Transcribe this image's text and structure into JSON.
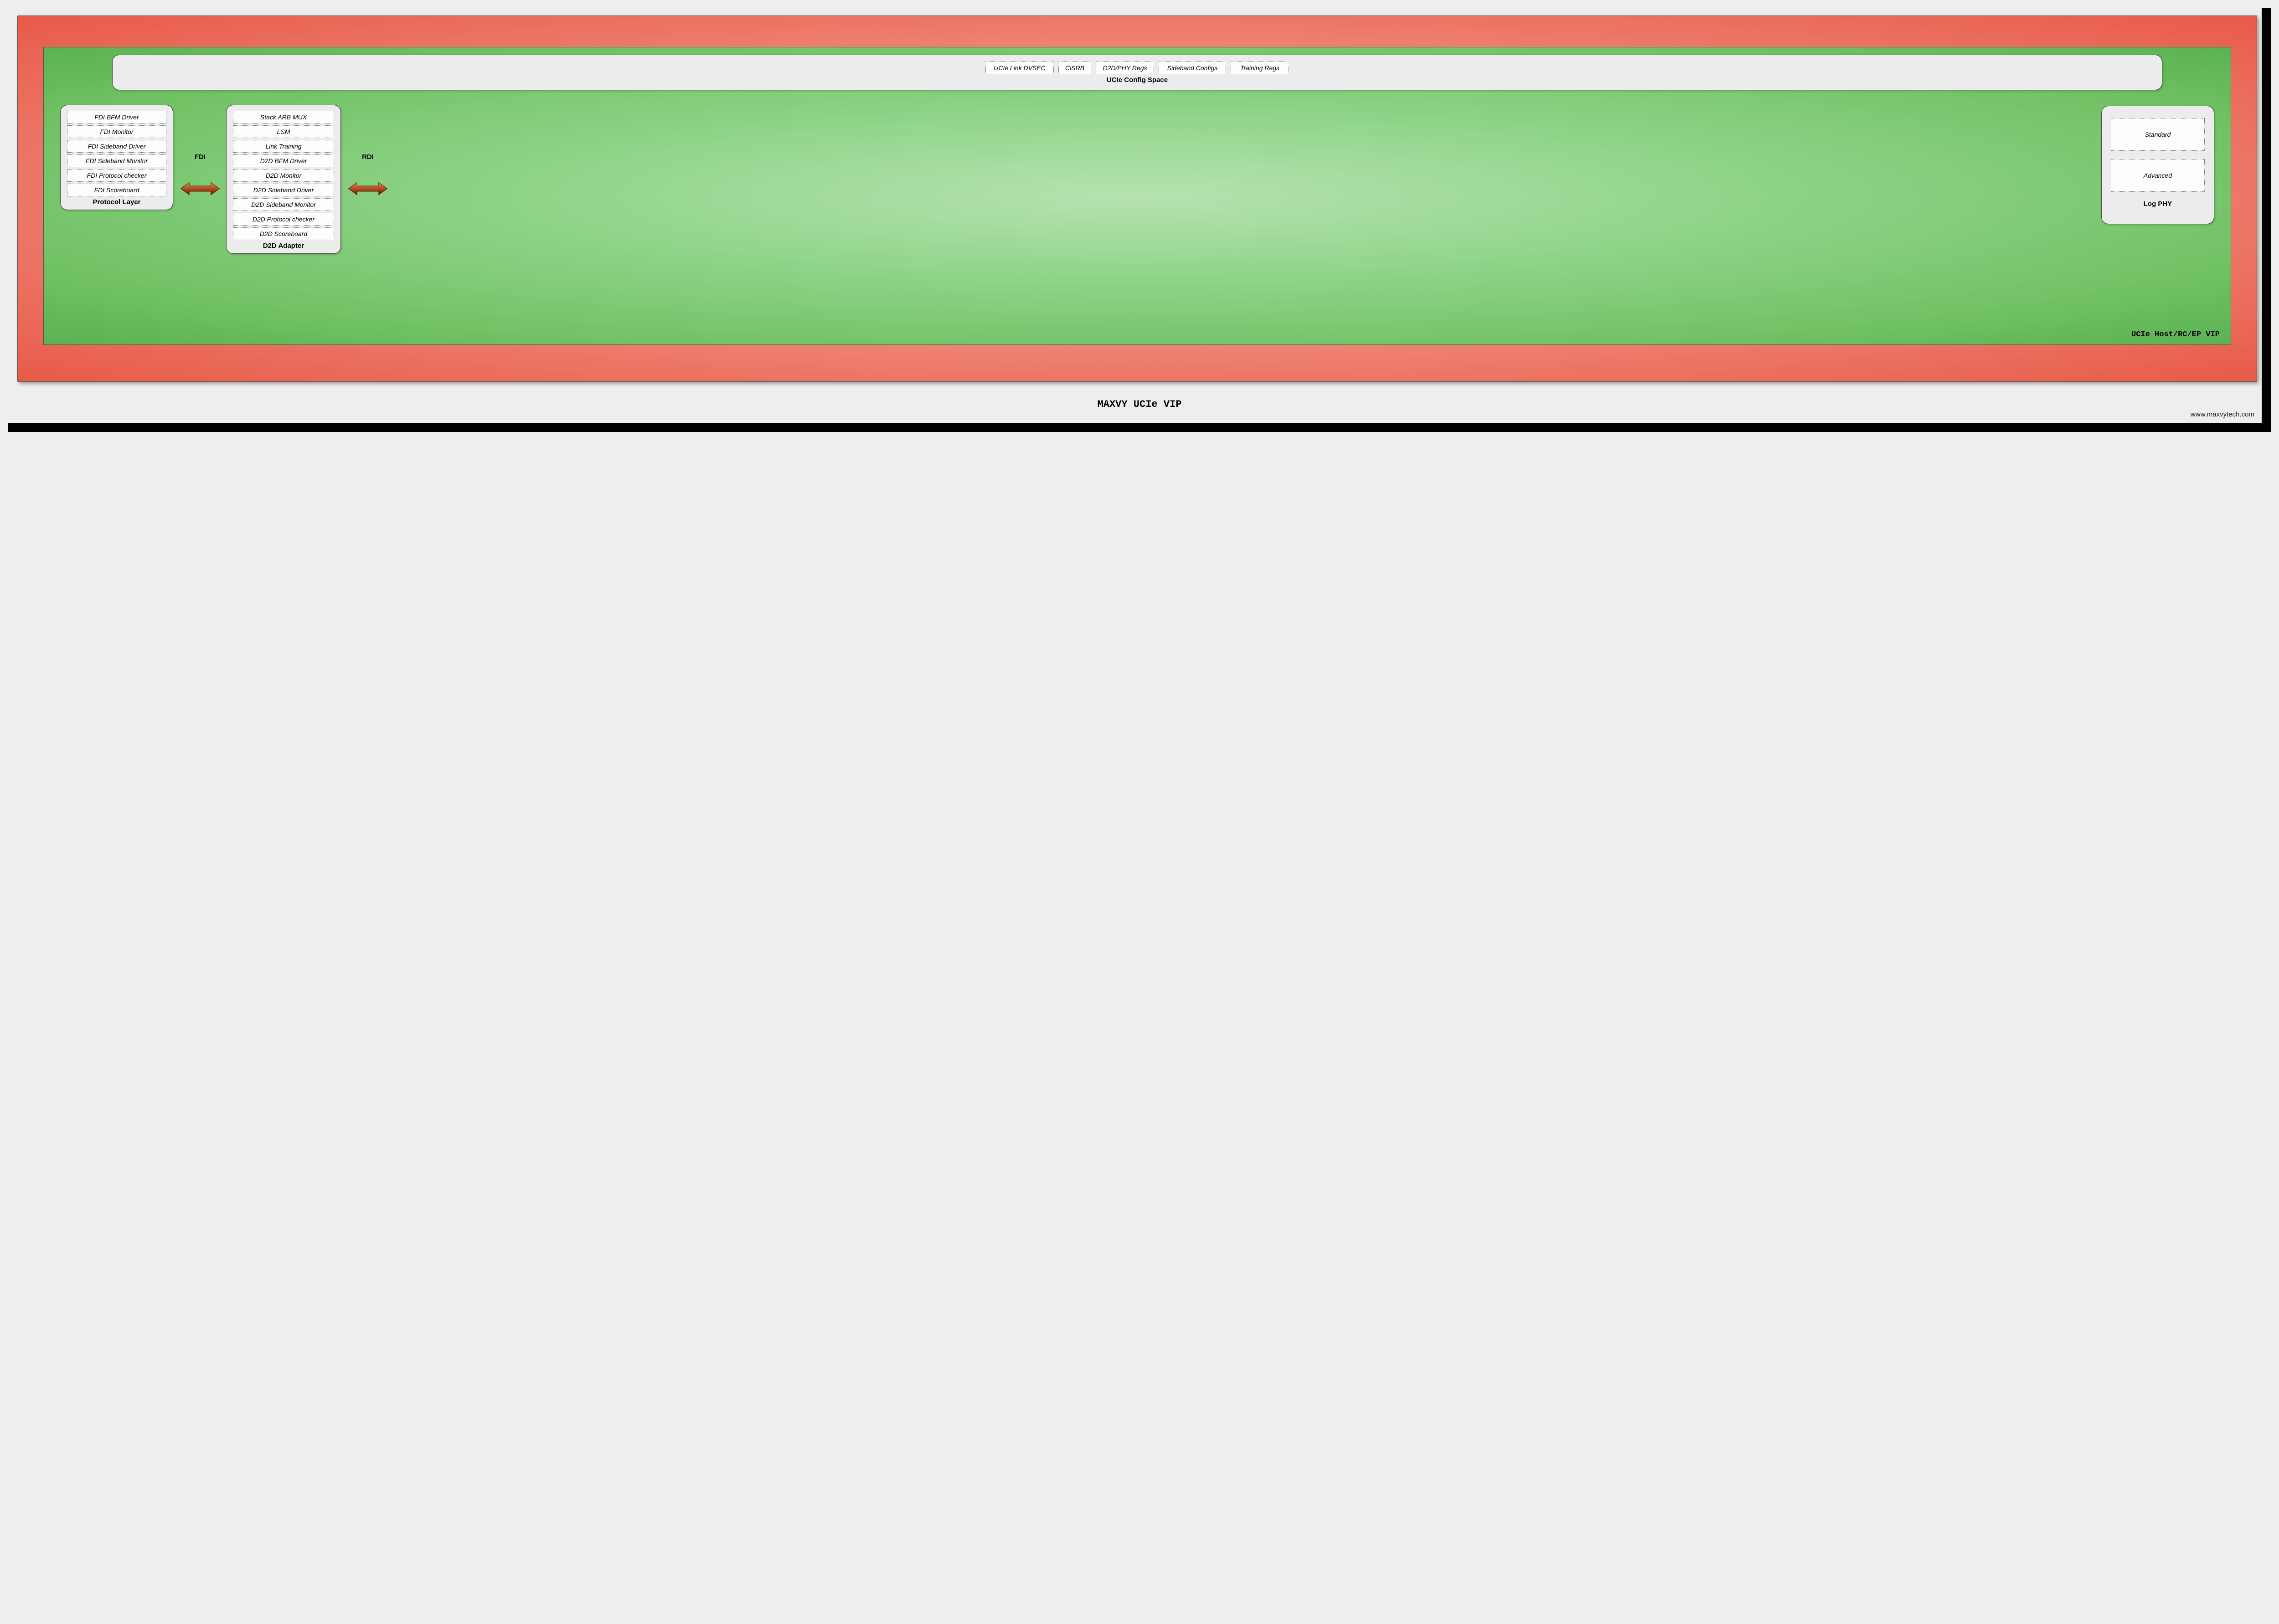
{
  "title": "MAXVY UCIe VIP",
  "url": "www.maxvytech.com",
  "inner_label": "UCIe Host/RC/EP VIP",
  "config_space": {
    "title": "UCIe Config Space",
    "items": [
      "UCIe Link DVSEC",
      "CiSRB",
      "D2D/PHY Regs",
      "Sideband Configs",
      "Training Regs"
    ]
  },
  "protocol_layer": {
    "title": "Protocol Layer",
    "items": [
      "FDI BFM Driver",
      "FDI Monitor",
      "FDI Sideband Driver",
      "FDI Sideband Monitor",
      "FDI Protocol checker",
      "FDI Scoreboard"
    ]
  },
  "d2d_adapter": {
    "title": "D2D Adapter",
    "items": [
      "Stack ARB MUX",
      "LSM",
      "Link Training",
      "D2D BFM Driver",
      "D2D Monitor",
      "D2D Sideband Driver",
      "D2D Sideband Monitor",
      "D2D Protocol checker",
      "D2D Scoreboard"
    ]
  },
  "log_phy": {
    "title": "Log PHY",
    "items": [
      "Standard",
      "Advanced"
    ]
  },
  "arrows": {
    "fdi": "FDI",
    "rdi": "RDI"
  },
  "colors": {
    "arrow_gradient_from": "#e86a2a",
    "arrow_gradient_to": "#7a1208"
  }
}
